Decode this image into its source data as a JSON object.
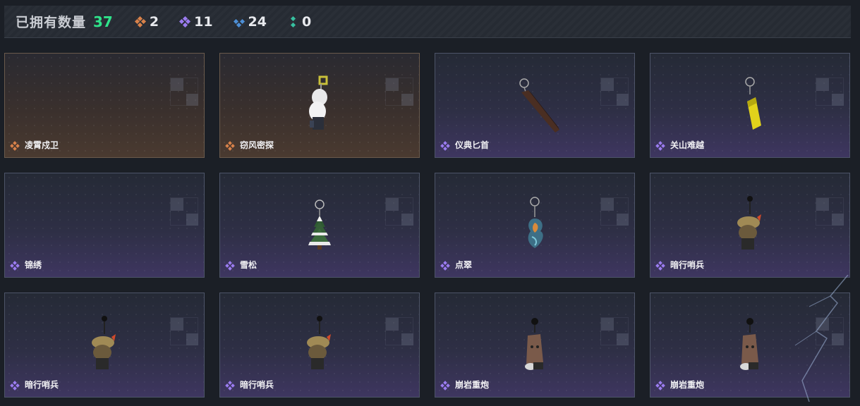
{
  "header": {
    "owned_label": "已拥有数量",
    "owned_total": "37",
    "stats": [
      {
        "rarity": "orange",
        "icon": "orange-rarity-icon",
        "value": "2"
      },
      {
        "rarity": "purple",
        "icon": "purple-rarity-icon",
        "value": "11"
      },
      {
        "rarity": "blue",
        "icon": "blue-rarity-icon",
        "value": "24"
      },
      {
        "rarity": "teal",
        "icon": "teal-rarity-icon",
        "value": "0"
      }
    ]
  },
  "colors": {
    "orange": "#d9824a",
    "purple": "#9b7cf0",
    "blue": "#4d8fd6",
    "teal": "#37c0a0",
    "total_green": "#2fe38a"
  },
  "items": [
    {
      "name": "凌霄戍卫",
      "rarity": "orange",
      "charm": "none"
    },
    {
      "name": "窃风密探",
      "rarity": "orange",
      "charm": "white-figure-charm"
    },
    {
      "name": "仪典匕首",
      "rarity": "purple",
      "charm": "dagger-charm"
    },
    {
      "name": "关山难越",
      "rarity": "purple",
      "charm": "yellow-cylinder-charm"
    },
    {
      "name": "锦绣",
      "rarity": "purple",
      "charm": "none"
    },
    {
      "name": "雪松",
      "rarity": "purple",
      "charm": "snow-tree-charm"
    },
    {
      "name": "点翠",
      "rarity": "purple",
      "charm": "phoenix-charm"
    },
    {
      "name": "暗行哨兵",
      "rarity": "purple",
      "charm": "sentinel-charm"
    },
    {
      "name": "暗行哨兵",
      "rarity": "purple",
      "charm": "sentinel-charm"
    },
    {
      "name": "暗行哨兵",
      "rarity": "purple",
      "charm": "sentinel-charm"
    },
    {
      "name": "崩岩重炮",
      "rarity": "purple",
      "charm": "rock-cannon-charm"
    },
    {
      "name": "崩岩重炮",
      "rarity": "purple",
      "charm": "rock-cannon-charm"
    }
  ]
}
